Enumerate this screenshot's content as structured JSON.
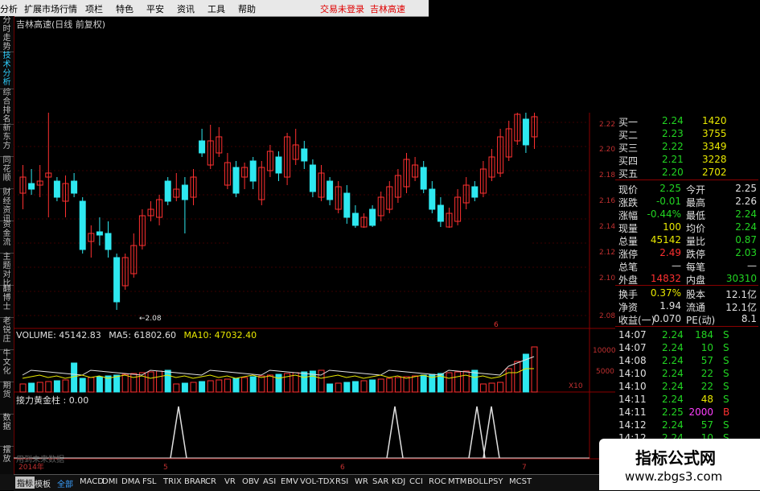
{
  "menu": {
    "items": [
      "分析",
      "扩展市场行情",
      "资讯",
      "特色",
      "平安",
      "资讯",
      "工具",
      "帮助"
    ],
    "login_status": "交易未登录",
    "stock_link": "吉林高速"
  },
  "left_tabs": [
    "分时走势",
    "技术分析",
    "综合排名",
    "新东方",
    "同花顺",
    "财经资讯",
    "资金流",
    "主题对比",
    "翻博士",
    "老锐庄",
    "牛文化",
    "期货",
    "数据",
    "摆放"
  ],
  "chart": {
    "title": "吉林高速(日线 前复权)",
    "low_marker": "2.08",
    "price_axis": [
      "2.22",
      "2.20",
      "2.18",
      "2.16",
      "2.14",
      "2.12",
      "2.10",
      "2.08"
    ],
    "hidden_mark": "6"
  },
  "volume": {
    "label": "VOLUME: 45142.83",
    "ma5": "MA5: 61802.60",
    "ma10": "MA10: 47032.40",
    "axis": [
      "10000",
      "5000"
    ],
    "unit": "X10"
  },
  "indicator": {
    "label": "接力黄金柱 : 0.00",
    "footnote": "用到未来数据"
  },
  "time_axis": {
    "year": "2014年",
    "months": [
      "5",
      "6",
      "7"
    ]
  },
  "quote": {
    "bids": [
      {
        "label": "买一",
        "price": "2.24",
        "vol": "1420"
      },
      {
        "label": "买二",
        "price": "2.23",
        "vol": "3755"
      },
      {
        "label": "买三",
        "price": "2.22",
        "vol": "3349"
      },
      {
        "label": "买四",
        "price": "2.21",
        "vol": "3228"
      },
      {
        "label": "买五",
        "price": "2.20",
        "vol": "2702"
      }
    ],
    "stats": [
      {
        "l1": "现价",
        "v1": "2.25",
        "c1": "g",
        "l2": "今开",
        "v2": "2.25",
        "c2": "w"
      },
      {
        "l1": "涨跌",
        "v1": "-0.01",
        "c1": "g",
        "l2": "最高",
        "v2": "2.26",
        "c2": "w"
      },
      {
        "l1": "涨幅",
        "v1": "-0.44%",
        "c1": "g",
        "l2": "最低",
        "v2": "2.24",
        "c2": "g"
      },
      {
        "l1": "现量",
        "v1": "100",
        "c1": "y",
        "l2": "均价",
        "v2": "2.24",
        "c2": "g"
      },
      {
        "l1": "总量",
        "v1": "45142",
        "c1": "y",
        "l2": "量比",
        "v2": "0.87",
        "c2": "g"
      },
      {
        "l1": "涨停",
        "v1": "2.49",
        "c1": "r",
        "l2": "跌停",
        "v2": "2.03",
        "c2": "g"
      },
      {
        "l1": "总笔",
        "v1": "—",
        "c1": "w",
        "l2": "每笔",
        "v2": "—",
        "c2": "w"
      },
      {
        "l1": "外盘",
        "v1": "14832",
        "c1": "r",
        "l2": "内盘",
        "v2": "30310",
        "c2": "g"
      },
      {
        "l1": "换手",
        "v1": "0.37%",
        "c1": "y",
        "l2": "股本",
        "v2": "12.1亿",
        "c2": "w"
      },
      {
        "l1": "净资",
        "v1": "1.94",
        "c1": "w",
        "l2": "流通",
        "v2": "12.1亿",
        "c2": "w"
      },
      {
        "l1": "收益(一)",
        "v1": "0.070",
        "c1": "w",
        "l2": "PE(动)",
        "v2": "8.1",
        "c2": "w"
      }
    ],
    "ticks": [
      {
        "time": "14:07",
        "price": "2.24",
        "vol": "184",
        "side": "S",
        "vc": "g",
        "sc": "g"
      },
      {
        "time": "14:07",
        "price": "2.24",
        "vol": "10",
        "side": "S",
        "vc": "g",
        "sc": "g"
      },
      {
        "time": "14:08",
        "price": "2.24",
        "vol": "57",
        "side": "S",
        "vc": "g",
        "sc": "g"
      },
      {
        "time": "14:10",
        "price": "2.24",
        "vol": "22",
        "side": "S",
        "vc": "g",
        "sc": "g"
      },
      {
        "time": "14:10",
        "price": "2.24",
        "vol": "22",
        "side": "S",
        "vc": "g",
        "sc": "g"
      },
      {
        "time": "14:11",
        "price": "2.24",
        "vol": "48",
        "side": "S",
        "vc": "y",
        "sc": "g"
      },
      {
        "time": "14:11",
        "price": "2.25",
        "vol": "2000",
        "side": "B",
        "vc": "m",
        "sc": "r"
      },
      {
        "time": "14:12",
        "price": "2.24",
        "vol": "57",
        "side": "S",
        "vc": "g",
        "sc": "g"
      },
      {
        "time": "14:12",
        "price": "2.24",
        "vol": "10",
        "side": "S",
        "vc": "g",
        "sc": "g"
      }
    ]
  },
  "bottom_tabs": [
    "指标",
    "模板",
    "全部",
    "MACD",
    "DMI",
    "DMA",
    "FSL",
    "TRIX",
    "BRAR",
    "CR",
    "VR",
    "OBV",
    "ASI",
    "EMV",
    "VOL-TDX",
    "RSI",
    "WR",
    "SAR",
    "KDJ",
    "CCI",
    "ROC",
    "MTM",
    "BOLL",
    "PSY",
    "MCST"
  ],
  "watermark": {
    "title": "指标公式网",
    "url": "www.zbgs3.com"
  },
  "colors": {
    "up": "#ff3030",
    "down": "#2ee8f0",
    "grid": "#8a0000",
    "volume_bar": "#2ee8f0"
  }
}
